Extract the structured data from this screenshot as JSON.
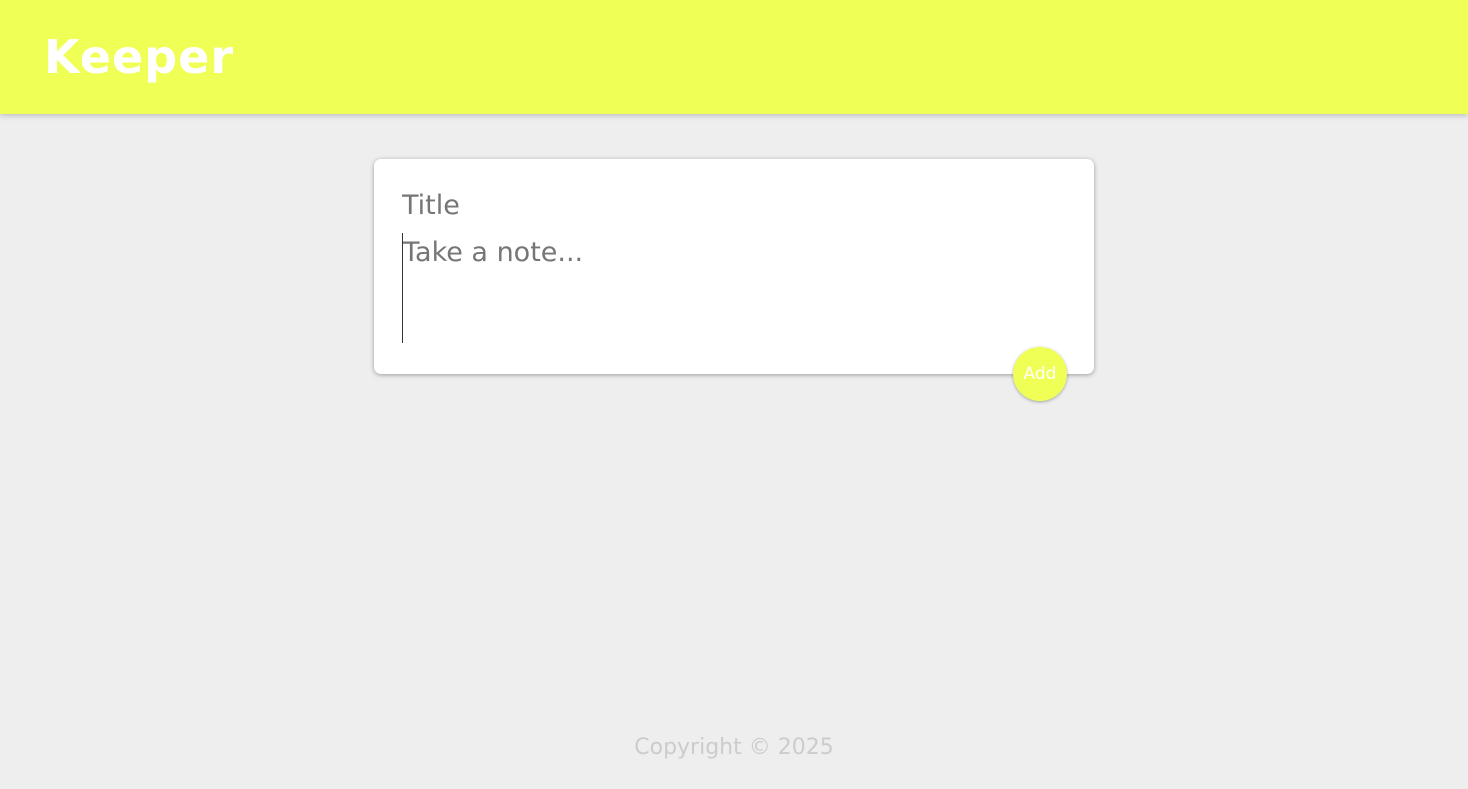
{
  "header": {
    "brand": "Keeper"
  },
  "note_form": {
    "title_placeholder": "Title",
    "title_value": "",
    "content_placeholder": "Take a note...",
    "content_value": "",
    "add_label": "Add"
  },
  "footer": {
    "copyright": "Copyright © 2025"
  },
  "colors": {
    "accent": "#f0ff55",
    "background": "#eeeeee",
    "card": "#ffffff",
    "footer_text": "#cccccc"
  }
}
